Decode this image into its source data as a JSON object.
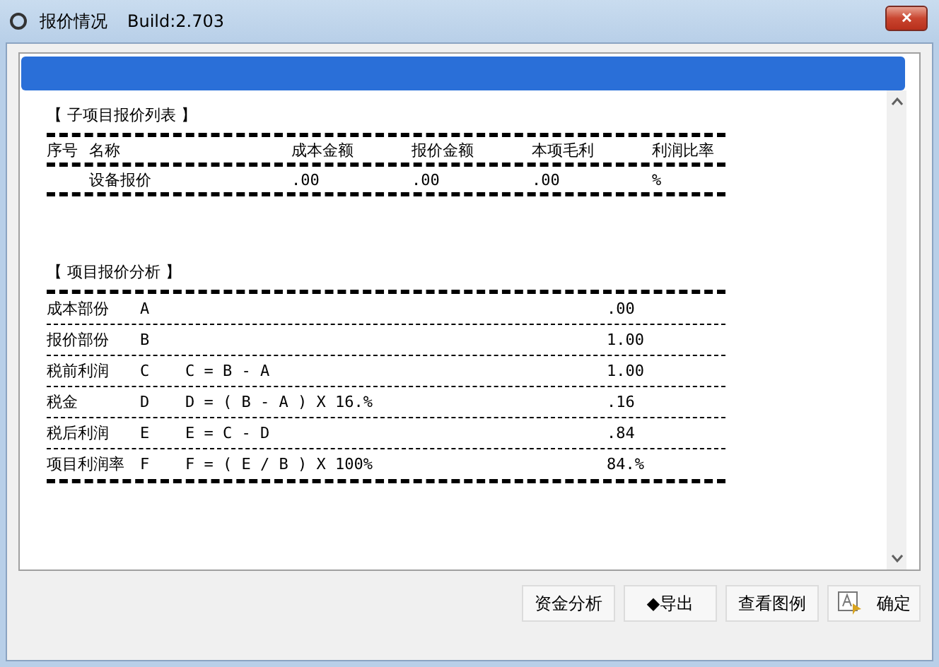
{
  "window": {
    "title": "报价情况",
    "build": "Build:2.703",
    "close": "✕"
  },
  "sub_list": {
    "title": "【 子项目报价列表 】",
    "columns": [
      "序号",
      "名称",
      "成本金额",
      "报价金额",
      "本项毛利",
      "利润比率"
    ],
    "rows": [
      {
        "cells": [
          "",
          "设备报价",
          ".00",
          ".00",
          ".00",
          "%"
        ]
      }
    ]
  },
  "analysis": {
    "title": "【 项目报价分析 】",
    "rows": [
      {
        "label": "成本部份",
        "letter": "A",
        "formula": "",
        "value": ".00"
      },
      {
        "label": "报价部份",
        "letter": "B",
        "formula": "",
        "value": "1.00"
      },
      {
        "label": "税前利润",
        "letter": "C",
        "formula": "C = B - A",
        "value": "1.00"
      },
      {
        "label": "税金",
        "letter": "D",
        "formula": "D = ( B - A ) X 16.%",
        "value": ".16"
      },
      {
        "label": "税后利润",
        "letter": "E",
        "formula": "E = C - D",
        "value": ".84"
      },
      {
        "label": "项目利润率",
        "letter": "F",
        "formula": "F = ( E / B ) X 100%",
        "value": "84.%"
      }
    ]
  },
  "buttons": [
    {
      "label": "资金分析",
      "kind": "text"
    },
    {
      "label": "◆导出",
      "kind": "text"
    },
    {
      "label": "查看图例",
      "kind": "text"
    },
    {
      "label": "确定",
      "kind": "icon"
    }
  ]
}
